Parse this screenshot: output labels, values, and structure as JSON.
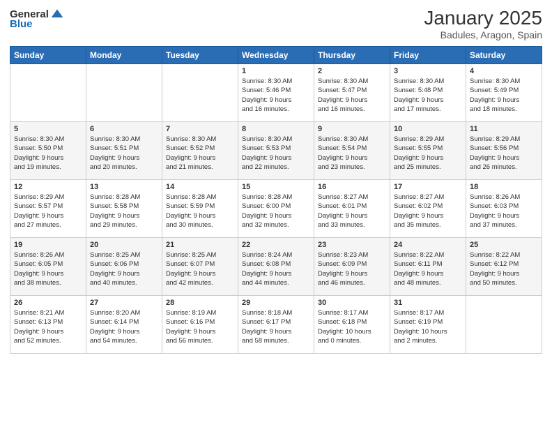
{
  "logo": {
    "general": "General",
    "blue": "Blue"
  },
  "header": {
    "month": "January 2025",
    "location": "Badules, Aragon, Spain"
  },
  "weekdays": [
    "Sunday",
    "Monday",
    "Tuesday",
    "Wednesday",
    "Thursday",
    "Friday",
    "Saturday"
  ],
  "weeks": [
    [
      {
        "day": "",
        "text": ""
      },
      {
        "day": "",
        "text": ""
      },
      {
        "day": "",
        "text": ""
      },
      {
        "day": "1",
        "text": "Sunrise: 8:30 AM\nSunset: 5:46 PM\nDaylight: 9 hours\nand 16 minutes."
      },
      {
        "day": "2",
        "text": "Sunrise: 8:30 AM\nSunset: 5:47 PM\nDaylight: 9 hours\nand 16 minutes."
      },
      {
        "day": "3",
        "text": "Sunrise: 8:30 AM\nSunset: 5:48 PM\nDaylight: 9 hours\nand 17 minutes."
      },
      {
        "day": "4",
        "text": "Sunrise: 8:30 AM\nSunset: 5:49 PM\nDaylight: 9 hours\nand 18 minutes."
      }
    ],
    [
      {
        "day": "5",
        "text": "Sunrise: 8:30 AM\nSunset: 5:50 PM\nDaylight: 9 hours\nand 19 minutes."
      },
      {
        "day": "6",
        "text": "Sunrise: 8:30 AM\nSunset: 5:51 PM\nDaylight: 9 hours\nand 20 minutes."
      },
      {
        "day": "7",
        "text": "Sunrise: 8:30 AM\nSunset: 5:52 PM\nDaylight: 9 hours\nand 21 minutes."
      },
      {
        "day": "8",
        "text": "Sunrise: 8:30 AM\nSunset: 5:53 PM\nDaylight: 9 hours\nand 22 minutes."
      },
      {
        "day": "9",
        "text": "Sunrise: 8:30 AM\nSunset: 5:54 PM\nDaylight: 9 hours\nand 23 minutes."
      },
      {
        "day": "10",
        "text": "Sunrise: 8:29 AM\nSunset: 5:55 PM\nDaylight: 9 hours\nand 25 minutes."
      },
      {
        "day": "11",
        "text": "Sunrise: 8:29 AM\nSunset: 5:56 PM\nDaylight: 9 hours\nand 26 minutes."
      }
    ],
    [
      {
        "day": "12",
        "text": "Sunrise: 8:29 AM\nSunset: 5:57 PM\nDaylight: 9 hours\nand 27 minutes."
      },
      {
        "day": "13",
        "text": "Sunrise: 8:28 AM\nSunset: 5:58 PM\nDaylight: 9 hours\nand 29 minutes."
      },
      {
        "day": "14",
        "text": "Sunrise: 8:28 AM\nSunset: 5:59 PM\nDaylight: 9 hours\nand 30 minutes."
      },
      {
        "day": "15",
        "text": "Sunrise: 8:28 AM\nSunset: 6:00 PM\nDaylight: 9 hours\nand 32 minutes."
      },
      {
        "day": "16",
        "text": "Sunrise: 8:27 AM\nSunset: 6:01 PM\nDaylight: 9 hours\nand 33 minutes."
      },
      {
        "day": "17",
        "text": "Sunrise: 8:27 AM\nSunset: 6:02 PM\nDaylight: 9 hours\nand 35 minutes."
      },
      {
        "day": "18",
        "text": "Sunrise: 8:26 AM\nSunset: 6:03 PM\nDaylight: 9 hours\nand 37 minutes."
      }
    ],
    [
      {
        "day": "19",
        "text": "Sunrise: 8:26 AM\nSunset: 6:05 PM\nDaylight: 9 hours\nand 38 minutes."
      },
      {
        "day": "20",
        "text": "Sunrise: 8:25 AM\nSunset: 6:06 PM\nDaylight: 9 hours\nand 40 minutes."
      },
      {
        "day": "21",
        "text": "Sunrise: 8:25 AM\nSunset: 6:07 PM\nDaylight: 9 hours\nand 42 minutes."
      },
      {
        "day": "22",
        "text": "Sunrise: 8:24 AM\nSunset: 6:08 PM\nDaylight: 9 hours\nand 44 minutes."
      },
      {
        "day": "23",
        "text": "Sunrise: 8:23 AM\nSunset: 6:09 PM\nDaylight: 9 hours\nand 46 minutes."
      },
      {
        "day": "24",
        "text": "Sunrise: 8:22 AM\nSunset: 6:11 PM\nDaylight: 9 hours\nand 48 minutes."
      },
      {
        "day": "25",
        "text": "Sunrise: 8:22 AM\nSunset: 6:12 PM\nDaylight: 9 hours\nand 50 minutes."
      }
    ],
    [
      {
        "day": "26",
        "text": "Sunrise: 8:21 AM\nSunset: 6:13 PM\nDaylight: 9 hours\nand 52 minutes."
      },
      {
        "day": "27",
        "text": "Sunrise: 8:20 AM\nSunset: 6:14 PM\nDaylight: 9 hours\nand 54 minutes."
      },
      {
        "day": "28",
        "text": "Sunrise: 8:19 AM\nSunset: 6:16 PM\nDaylight: 9 hours\nand 56 minutes."
      },
      {
        "day": "29",
        "text": "Sunrise: 8:18 AM\nSunset: 6:17 PM\nDaylight: 9 hours\nand 58 minutes."
      },
      {
        "day": "30",
        "text": "Sunrise: 8:17 AM\nSunset: 6:18 PM\nDaylight: 10 hours\nand 0 minutes."
      },
      {
        "day": "31",
        "text": "Sunrise: 8:17 AM\nSunset: 6:19 PM\nDaylight: 10 hours\nand 2 minutes."
      },
      {
        "day": "",
        "text": ""
      }
    ]
  ]
}
